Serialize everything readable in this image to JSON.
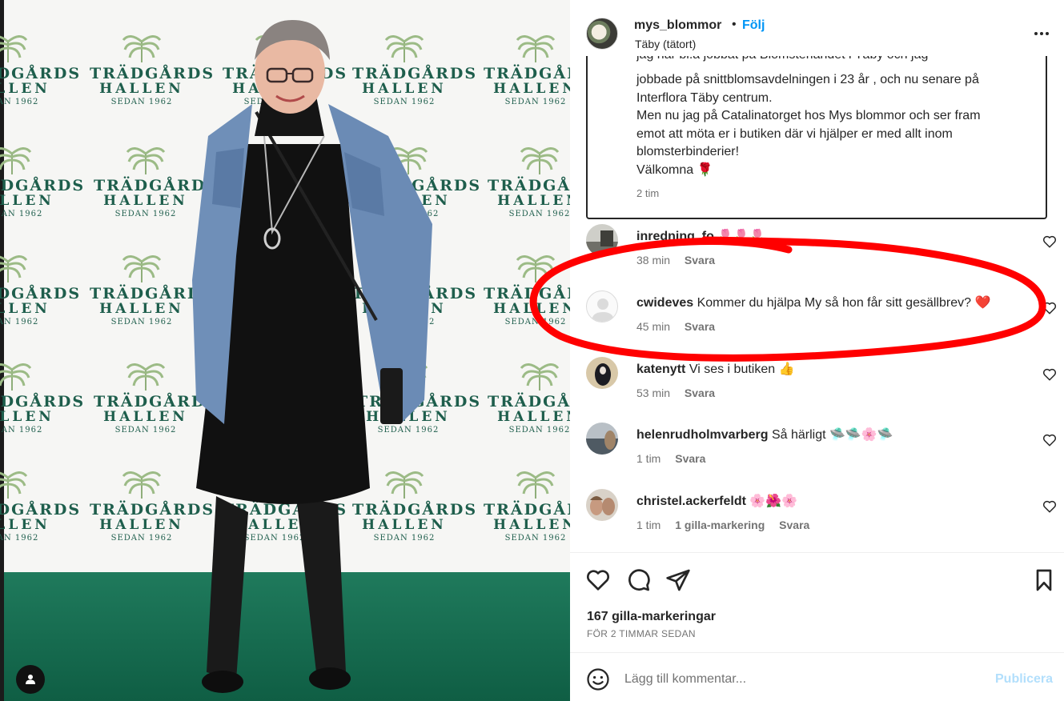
{
  "photo": {
    "backdrop_logo": {
      "line1": "TRÄDGÅRDS",
      "line2": "HALLEN",
      "line3": "SEDAN 1962"
    }
  },
  "header": {
    "username": "mys_blommor",
    "separator": "•",
    "follow_label": "Följ",
    "location": "Täby (tätort)"
  },
  "caption": {
    "clipped_line": "jag har bl.a jobbat på Blomsterlandet i Täby och jag",
    "text": "jobbade på snittblomsavdelningen i 23 år , och nu senare på\nInterflora Täby centrum.\nMen nu jag på Catalinatorget hos Mys blommor och ser fram\nemot att möta er i butiken där vi hjälper er med allt inom\nblomsterbinderier!\nVälkomna 🌹",
    "time": "2 tim"
  },
  "comments": [
    {
      "user": "inredning_fo",
      "text": "🌷🌷🌷",
      "time": "38 min",
      "reply": "Svara"
    },
    {
      "user": "cwideves",
      "text": "Kommer du hjälpa My så hon får sitt gesällbrev? ❤️",
      "time": "45 min",
      "reply": "Svara"
    },
    {
      "user": "katenytt",
      "text": "Vi ses i butiken 👍",
      "time": "53 min",
      "reply": "Svara"
    },
    {
      "user": "helenrudholmvarberg",
      "text": "Så härligt 🛸🛸🌸🛸",
      "time": "1 tim",
      "reply": "Svara"
    },
    {
      "user": "christel.ackerfeldt",
      "text": "🌸🌺🌸",
      "time": "1 tim",
      "likes": "1 gilla-markering",
      "reply": "Svara"
    }
  ],
  "actions": {
    "like_icon": "heart-icon",
    "comment_icon": "speech-bubble-icon",
    "share_icon": "paper-plane-icon",
    "save_icon": "bookmark-icon"
  },
  "likes_total": "167 gilla-markeringar",
  "posted_ago": "FÖR 2 TIMMAR SEDAN",
  "add_comment": {
    "placeholder": "Lägg till kommentar...",
    "publish_label": "Publicera"
  },
  "colors": {
    "link_blue": "#0095f6",
    "publish_disabled": "#b2dffc",
    "annotation_red": "#ff0000",
    "backdrop_green": "#1e5e4c"
  }
}
